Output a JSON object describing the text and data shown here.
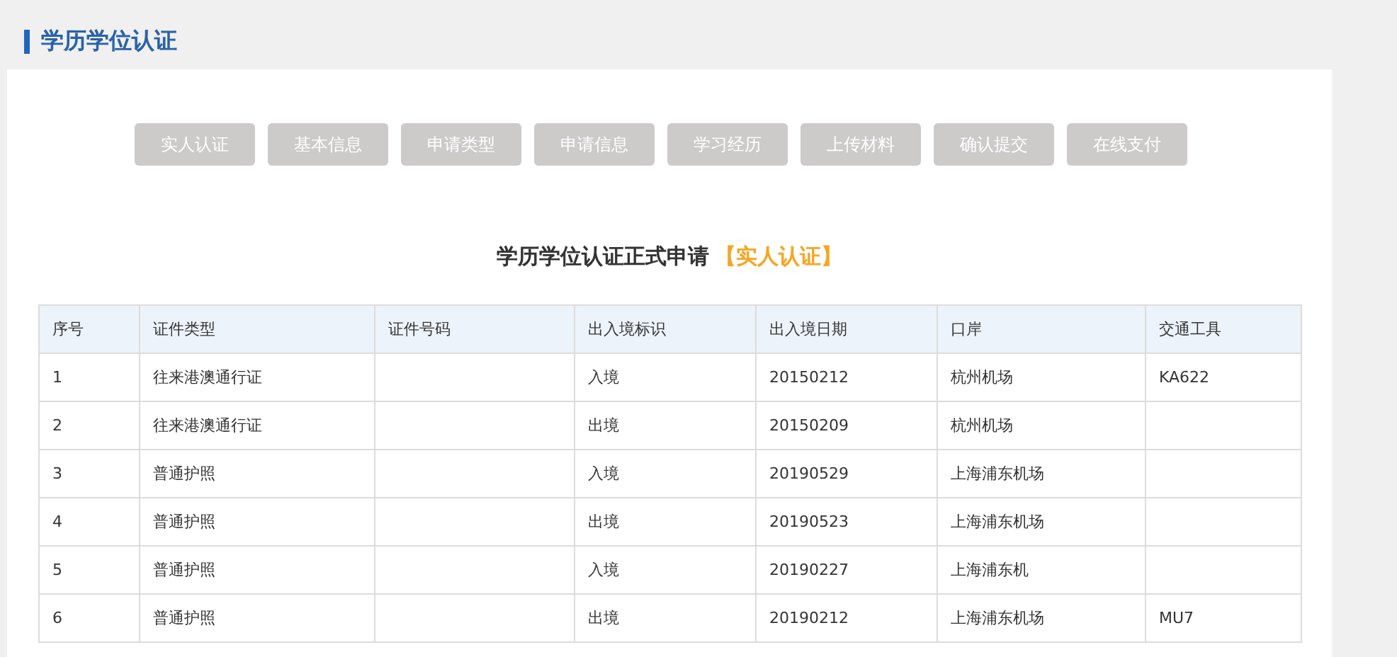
{
  "page_title": "学历学位认证",
  "steps": [
    {
      "label": "实人认证",
      "selected": false
    },
    {
      "label": "基本信息",
      "selected": false
    },
    {
      "label": "申请类型",
      "selected": false
    },
    {
      "label": "申请信息",
      "selected": false
    },
    {
      "label": "学习经历",
      "selected": false
    },
    {
      "label": "上传材料",
      "selected": false
    },
    {
      "label": "确认提交",
      "selected": false
    },
    {
      "label": "在线支付",
      "selected": false
    }
  ],
  "form_title": "学历学位认证正式申请",
  "form_step": "【实人认证】",
  "table": {
    "columns": [
      "序号",
      "证件类型",
      "证件号码",
      "出入境标识",
      "出入境日期",
      "口岸",
      "交通工具"
    ],
    "rows": [
      [
        "1",
        "往来港澳通行证",
        null,
        "入境",
        "20150212",
        "杭州机场",
        "KA622"
      ],
      [
        "2",
        "往来港澳通行证",
        null,
        "出境",
        "20150209",
        "杭州机场",
        null
      ],
      [
        "3",
        "普通护照",
        null,
        "入境",
        "20190529",
        "上海浦东机场",
        null
      ],
      [
        "4",
        "普通护照",
        null,
        "出境",
        "20190523",
        "上海浦东机场",
        null
      ],
      [
        "5",
        "普通护照",
        null,
        "入境",
        "20190227",
        "上海浦东机",
        null
      ],
      [
        "6",
        "普通护照",
        null,
        "出境",
        "20190212",
        "上海浦东机场",
        "MU7"
      ]
    ]
  }
}
